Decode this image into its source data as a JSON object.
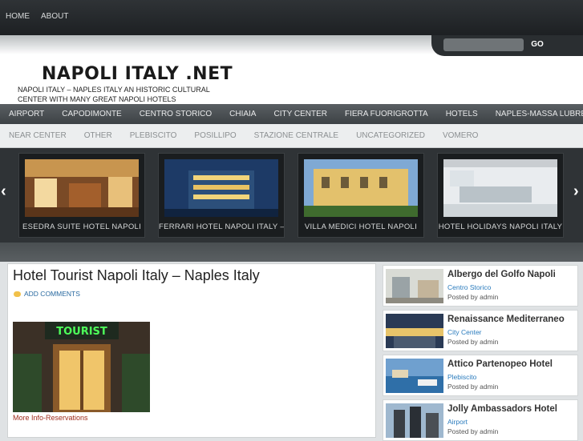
{
  "top_nav": [
    "HOME",
    "ABOUT"
  ],
  "search": {
    "button_label": "GO",
    "placeholder": ""
  },
  "site": {
    "title": "NAPOLI ITALY .NET",
    "tagline": "NAPOLI ITALY – NAPLES ITALY AN HISTORIC CULTURAL CENTER WITH MANY GREAT NAPOLI HOTELS"
  },
  "categories_primary": [
    "AIRPORT",
    "CAPODIMONTE",
    "CENTRO STORICO",
    "CHIAIA",
    "CITY CENTER",
    "FIERA FUORIGROTTA",
    "HOTELS",
    "NAPLES-MASSA LUBRENS"
  ],
  "categories_secondary": [
    "NEAR CENTER",
    "OTHER",
    "PLEBISCITO",
    "POSILLIPO",
    "STAZIONE CENTRALE",
    "UNCATEGORIZED",
    "VOMERO"
  ],
  "slider": {
    "prev": "‹",
    "next": "›",
    "slides": [
      {
        "caption": "ESEDRA SUITE HOTEL NAPOLI"
      },
      {
        "caption": "FERRARI HOTEL NAPOLI ITALY –"
      },
      {
        "caption": "VILLA MEDICI HOTEL NAPOLI"
      },
      {
        "caption": "HOTEL HOLIDAYS NAPOLI ITALY"
      }
    ]
  },
  "post": {
    "title": "Hotel Tourist Napoli Italy – Naples Italy",
    "comments_label": "ADD COMMENTS",
    "image_sign": "TOURIST",
    "more_link": "More Info-Reservations"
  },
  "sidebar": [
    {
      "title": "Albergo del Golfo Napoli",
      "category": "Centro Storico",
      "posted": "Posted by admin"
    },
    {
      "title": "Renaissance Mediterraneo",
      "category": "City Center",
      "posted": "Posted by admin"
    },
    {
      "title": "Attico Partenopeo Hotel",
      "category": "Plebiscito",
      "posted": "Posted by admin"
    },
    {
      "title": "Jolly Ambassadors Hotel",
      "category": "Airport",
      "posted": "Posted by admin"
    }
  ]
}
